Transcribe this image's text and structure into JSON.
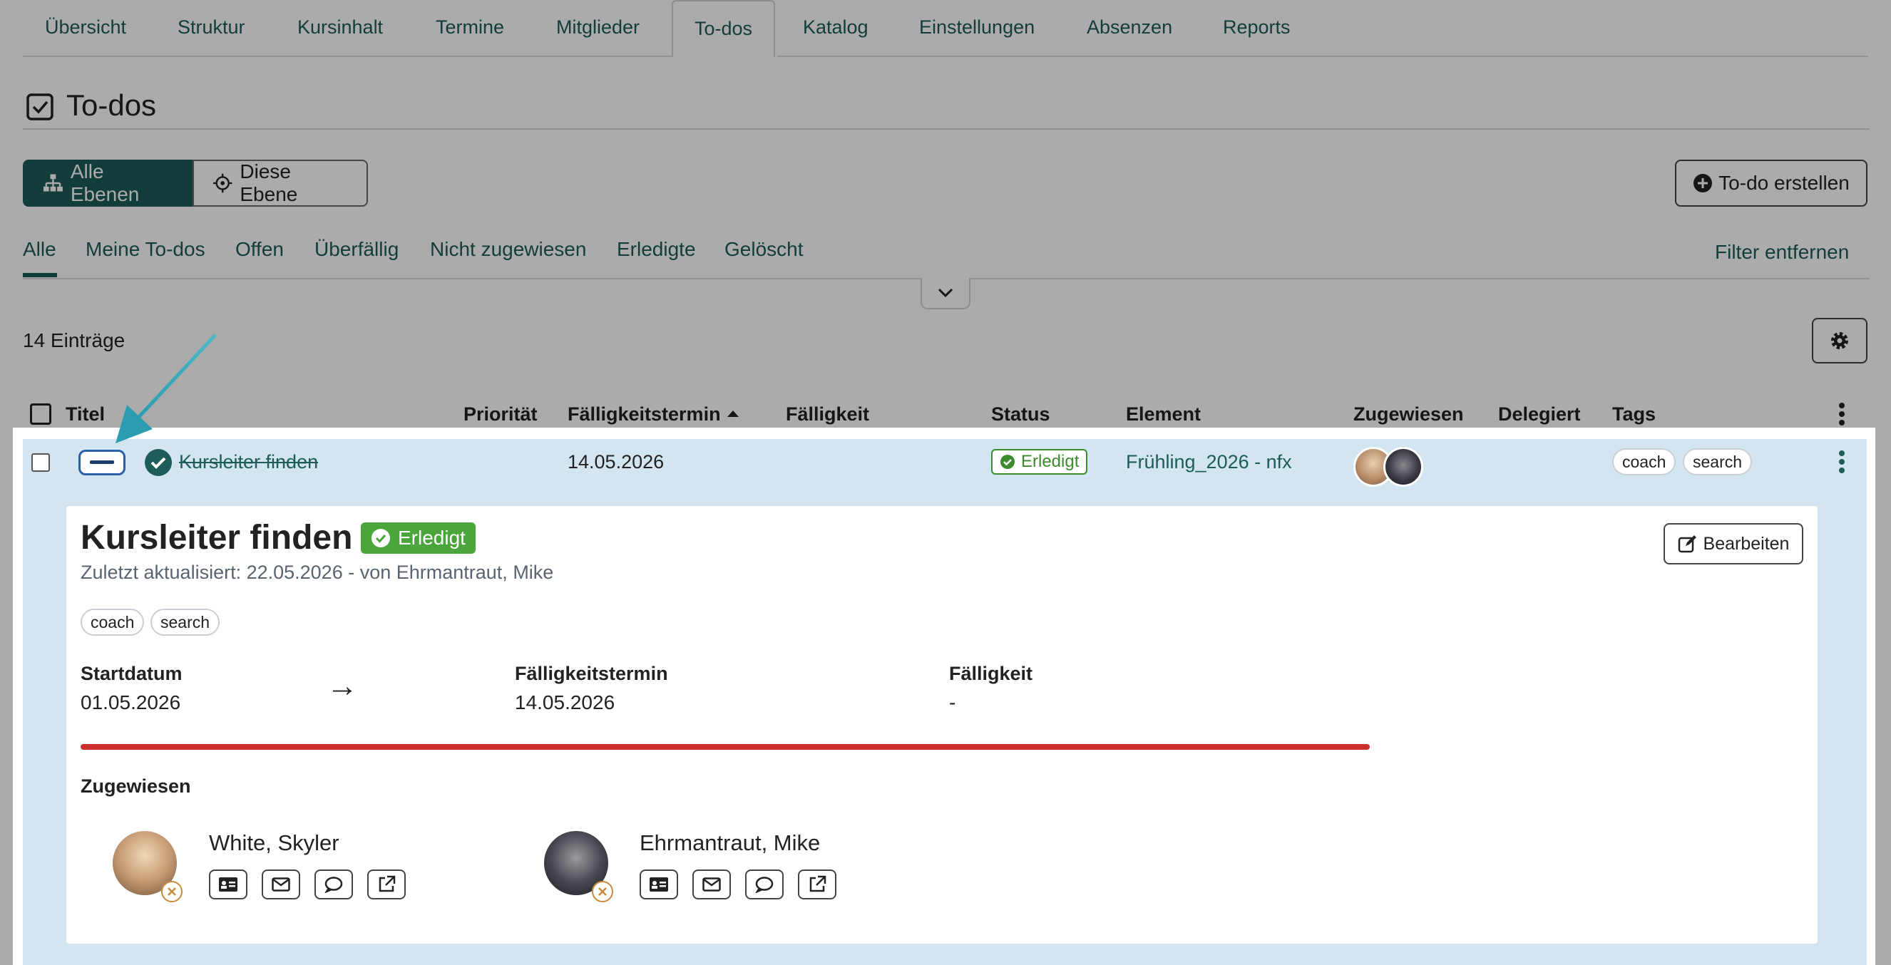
{
  "tabs": [
    "Übersicht",
    "Struktur",
    "Kursinhalt",
    "Termine",
    "Mitglieder",
    "To-dos",
    "Katalog",
    "Einstellungen",
    "Absenzen",
    "Reports"
  ],
  "active_tab": "To-dos",
  "page_title": "To-dos",
  "scope": {
    "all_levels": "Alle Ebenen",
    "this_level": "Diese Ebene"
  },
  "create_button": "To-do erstellen",
  "filters": [
    "Alle",
    "Meine To-dos",
    "Offen",
    "Überfällig",
    "Nicht zugewiesen",
    "Erledigte",
    "Gelöscht"
  ],
  "remove_filter": "Filter entfernen",
  "entry_count": "14 Einträge",
  "columns": {
    "title": "Titel",
    "priority": "Priorität",
    "due_date": "Fälligkeitstermin",
    "due": "Fälligkeit",
    "status": "Status",
    "element": "Element",
    "assigned": "Zugewiesen",
    "delegated": "Delegiert",
    "tags": "Tags"
  },
  "row": {
    "title": "Kursleiter finden",
    "due_date": "14.05.2026",
    "status": "Erledigt",
    "element": "Frühling_2026 - nfx",
    "tags": [
      "coach",
      "search"
    ]
  },
  "detail": {
    "title": "Kursleiter finden",
    "status": "Erledigt",
    "updated": "Zuletzt aktualisiert: 22.05.2026 - von Ehrmantraut, Mike",
    "edit_button": "Bearbeiten",
    "tags": [
      "coach",
      "search"
    ],
    "start_label": "Startdatum",
    "start_value": "01.05.2026",
    "arrow": "→",
    "due_date_label": "Fälligkeitstermin",
    "due_date_value": "14.05.2026",
    "due_label": "Fälligkeit",
    "due_value": "-",
    "progress": 1.0,
    "assigned_label": "Zugewiesen",
    "people": [
      {
        "name": "White, Skyler"
      },
      {
        "name": "Ehrmantraut, Mike"
      }
    ]
  },
  "colors": {
    "accent": "#1d5c57",
    "success": "#4aa63a",
    "progress": "#c9302c",
    "highlight_row": "#d2e5f1"
  }
}
